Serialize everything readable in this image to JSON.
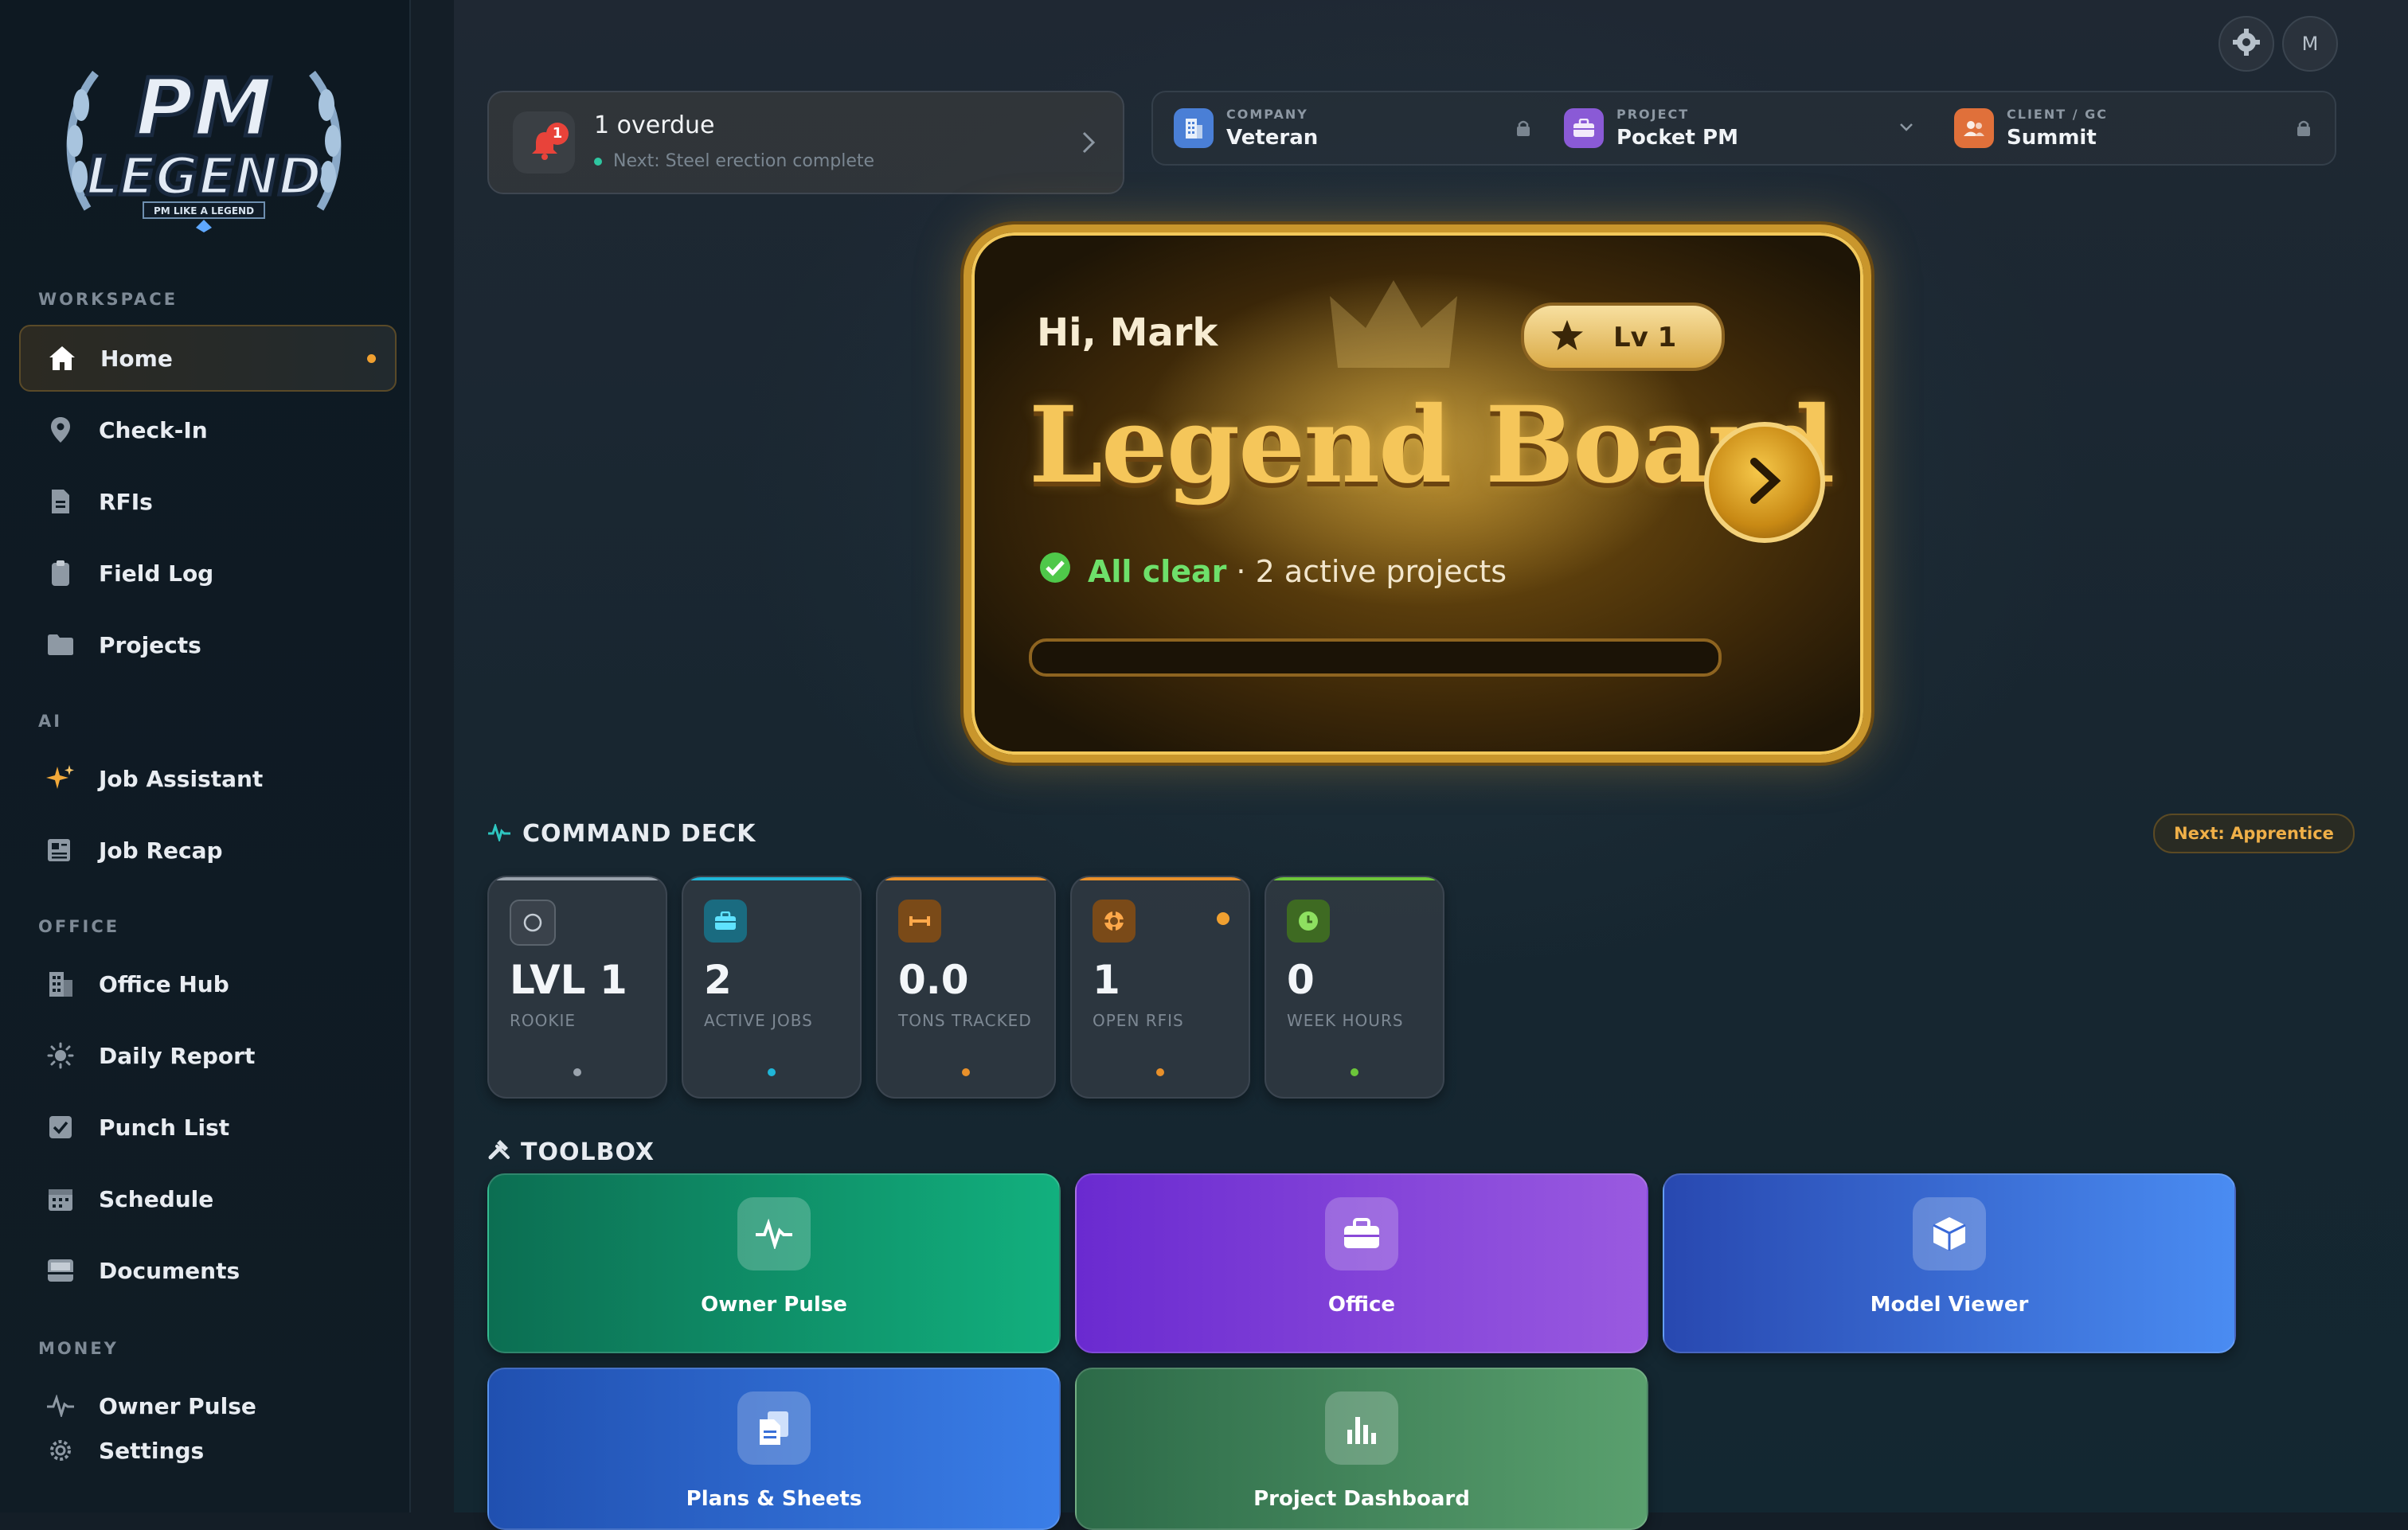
{
  "brand": {
    "logo_line1": "PM",
    "logo_line2": "LEGEND",
    "logo_tagline": "PM LIKE A LEGEND"
  },
  "sidebar": {
    "sections": [
      {
        "label": "WORKSPACE"
      },
      {
        "label": "AI"
      },
      {
        "label": "OFFICE"
      },
      {
        "label": "MONEY"
      }
    ],
    "items": [
      {
        "label": "Home",
        "icon": "home-icon",
        "active": true
      },
      {
        "label": "Check-In",
        "icon": "map-pin-icon"
      },
      {
        "label": "RFIs",
        "icon": "file-icon"
      },
      {
        "label": "Field Log",
        "icon": "clipboard-icon"
      },
      {
        "label": "Projects",
        "icon": "folder-icon"
      },
      {
        "label": "Job Assistant",
        "icon": "sparkles-icon"
      },
      {
        "label": "Job Recap",
        "icon": "newspaper-icon"
      },
      {
        "label": "Office Hub",
        "icon": "building-icon"
      },
      {
        "label": "Daily Report",
        "icon": "sun-icon"
      },
      {
        "label": "Punch List",
        "icon": "checkbox-icon"
      },
      {
        "label": "Schedule",
        "icon": "calendar-icon"
      },
      {
        "label": "Documents",
        "icon": "inbox-icon"
      },
      {
        "label": "Owner Pulse",
        "icon": "pulse-icon"
      },
      {
        "label": "Settings",
        "icon": "gear-icon"
      }
    ]
  },
  "header": {
    "avatar_initial": "M",
    "overdue": {
      "badge": "1",
      "title": "1 overdue",
      "next": "Next: Steel erection complete"
    },
    "context": {
      "company": {
        "label": "COMPANY",
        "value": "Veteran"
      },
      "project": {
        "label": "PROJECT",
        "value": "Pocket PM"
      },
      "client": {
        "label": "CLIENT / GC",
        "value": "Summit"
      }
    }
  },
  "hero": {
    "greeting": "Hi, Mark",
    "level": "Lv 1",
    "title": "Legend Board",
    "status_ok": "All clear",
    "status_rest": "· 2 active projects",
    "progress": 0
  },
  "deck": {
    "title": "COMMAND DECK",
    "next_rank": "Next: Apprentice",
    "stats": [
      {
        "value": "LVL 1",
        "label": "ROOKIE",
        "color": "#9aa3ad"
      },
      {
        "value": "2",
        "label": "ACTIVE JOBS",
        "color": "#1fb6d8"
      },
      {
        "value": "0.0",
        "label": "TONS TRACKED",
        "color": "#e8902a"
      },
      {
        "value": "1",
        "label": "OPEN RFIS",
        "color": "#e8902a"
      },
      {
        "value": "0",
        "label": "WEEK HOURS",
        "color": "#6cc63a"
      }
    ]
  },
  "toolbox": {
    "title": "TOOLBOX",
    "tools": [
      {
        "label": "Owner Pulse",
        "icon": "pulse-icon"
      },
      {
        "label": "Office",
        "icon": "briefcase-icon"
      },
      {
        "label": "Model Viewer",
        "icon": "cube-icon"
      },
      {
        "label": "Plans & Sheets",
        "icon": "files-icon"
      },
      {
        "label": "Project Dashboard",
        "icon": "bar-chart-icon"
      }
    ]
  }
}
